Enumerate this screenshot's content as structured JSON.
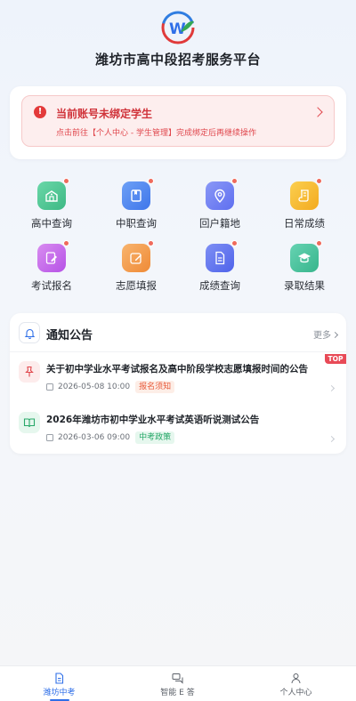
{
  "header": {
    "logo_icon": "w-logo-icon",
    "title": "潍坊市高中段招考服务平台"
  },
  "alert": {
    "icon": "alert-circle-icon",
    "title": "当前账号未绑定学生",
    "description": "点击前往【个人中心 - 学生管理】完成绑定后再继续操作",
    "chevron": "chevron-right-icon",
    "color": "#d0333a"
  },
  "menu": {
    "items": [
      {
        "label": "高中查询",
        "icon": "school-icon",
        "color": "#4cc492"
      },
      {
        "label": "中职查询",
        "icon": "book-icon",
        "color": "#4f86f0"
      },
      {
        "label": "回户籍地",
        "icon": "location-icon",
        "color": "#6b7cf2"
      },
      {
        "label": "日常成绩",
        "icon": "scroll-icon",
        "color": "#f5b731"
      },
      {
        "label": "考试报名",
        "icon": "edit-icon",
        "color": "#c768ea"
      },
      {
        "label": "志愿填报",
        "icon": "pen-icon",
        "color": "#f49d4d"
      },
      {
        "label": "成绩查询",
        "icon": "document-icon",
        "color": "#5d72ec"
      },
      {
        "label": "录取结果",
        "icon": "graduation-cap-icon",
        "color": "#4cc4a0"
      }
    ]
  },
  "notices": {
    "title": "通知公告",
    "more_label": "更多",
    "top_badge": "TOP",
    "items": [
      {
        "title": "关于初中学业水平考试报名及高中阶段学校志愿填报时间的公告",
        "date": "2026-05-08 10:00",
        "tag": "报名须知",
        "icon": "pin-icon",
        "tag_color": "#e85a3a",
        "tag_bg": "#fdeee7"
      },
      {
        "title": "2026年潍坊市初中学业水平考试英语听说测试公告",
        "date": "2026-03-06 09:00",
        "tag": "中考政策",
        "icon": "open-book-icon",
        "tag_color": "#28a869",
        "tag_bg": "#e6f7ee"
      }
    ]
  },
  "tabbar": {
    "tabs": [
      {
        "label": "潍坊中考",
        "icon": "document-icon",
        "active": true
      },
      {
        "label": "智能 E 答",
        "icon": "chat-icon",
        "active": false
      },
      {
        "label": "个人中心",
        "icon": "user-icon",
        "active": false
      }
    ],
    "active_color": "#2f6fe8"
  }
}
